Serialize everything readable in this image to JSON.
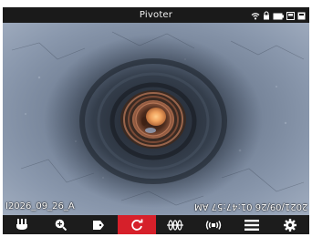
{
  "statusbar": {
    "title": "Pivoter",
    "icons": [
      "wifi-icon",
      "lock-icon",
      "battery-icon",
      "sd-card-icon",
      "storage-icon"
    ]
  },
  "camera": {
    "overlay_left": "I2026_09_26_A",
    "overlay_right": "2021/09/26 01:47:57 AM"
  },
  "toolbar": {
    "active_color": "#d6202a",
    "buttons": [
      {
        "icon": "tray-icon",
        "active": false
      },
      {
        "icon": "zoom-in-icon",
        "active": false
      },
      {
        "icon": "tag-icon",
        "active": false
      },
      {
        "icon": "rotate-icon",
        "active": true
      },
      {
        "icon": "coil-icon",
        "active": false
      },
      {
        "icon": "sonde-icon",
        "active": false
      },
      {
        "icon": "menu-icon",
        "active": false
      },
      {
        "icon": "settings-icon",
        "active": false
      }
    ]
  }
}
